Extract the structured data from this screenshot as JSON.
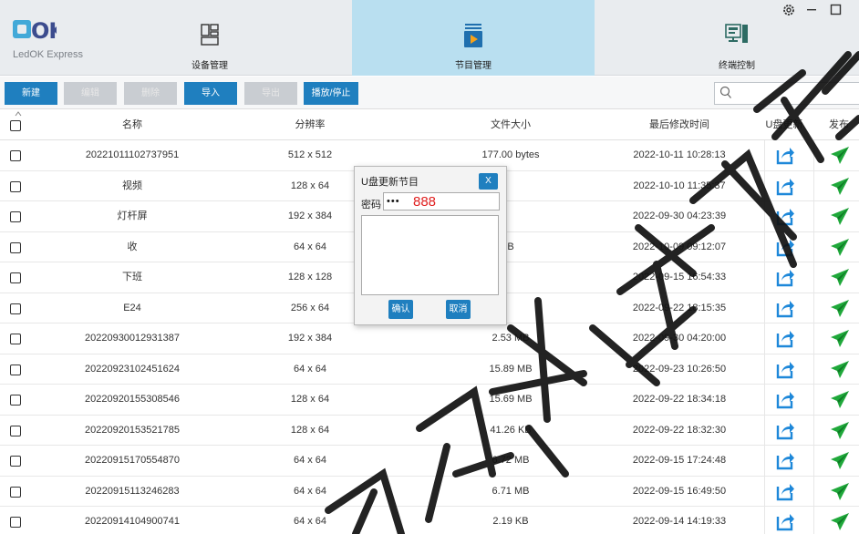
{
  "app": {
    "logo_text": "OK",
    "name": "LedOK Express"
  },
  "nav": {
    "device_label": "设备管理",
    "program_label": "节目管理",
    "terminal_label": "终端控制"
  },
  "window_controls": {
    "settings_icon": "gear-icon",
    "minimize_icon": "minimize-icon",
    "maximize_icon": "maximize-icon"
  },
  "toolbar": {
    "new_label": "新建",
    "edit_label": "编辑",
    "delete_label": "删除",
    "import_label": "导入",
    "export_label": "导出",
    "play_stop_label": "播放/停止",
    "search_placeholder": ""
  },
  "table": {
    "headers": {
      "name": "名称",
      "resolution": "分辨率",
      "size": "文件大小",
      "modified": "最后修改时间",
      "usb_update": "U盘更新",
      "publish": "发布"
    },
    "rows": [
      {
        "name": "20221011102737951",
        "resolution": "512 x 512",
        "size": "177.00 bytes",
        "modified": "2022-10-11 10:28:13"
      },
      {
        "name": "视频",
        "resolution": "128 x 64",
        "size": "",
        "modified": "2022-10-10 11:35:37"
      },
      {
        "name": "灯杆屏",
        "resolution": "192 x 384",
        "size": "",
        "modified": "2022-09-30 04:23:39"
      },
      {
        "name": "收",
        "resolution": "64 x 64",
        "size": "B",
        "modified": "2022-10-09 09:12:07"
      },
      {
        "name": "下班",
        "resolution": "128 x 128",
        "size": "",
        "modified": "2022-09-15 16:54:33"
      },
      {
        "name": "E24",
        "resolution": "256 x 64",
        "size": "",
        "modified": "2022-09-22 18:15:35"
      },
      {
        "name": "20220930012931387",
        "resolution": "192 x 384",
        "size": "2.53 MB",
        "modified": "2022-09-30 04:20:00"
      },
      {
        "name": "20220923102451624",
        "resolution": "64 x 64",
        "size": "15.89 MB",
        "modified": "2022-09-23 10:26:50"
      },
      {
        "name": "20220920155308546",
        "resolution": "128 x 64",
        "size": "15.69 MB",
        "modified": "2022-09-22 18:34:18"
      },
      {
        "name": "20220920153521785",
        "resolution": "128 x 64",
        "size": "41.26 KB",
        "modified": "2022-09-22 18:32:30"
      },
      {
        "name": "20220915170554870",
        "resolution": "64 x 64",
        "size": "6.72 MB",
        "modified": "2022-09-15 17:24:48"
      },
      {
        "name": "20220915113246283",
        "resolution": "64 x 64",
        "size": "6.71 MB",
        "modified": "2022-09-15 16:49:50"
      },
      {
        "name": "20220914104900741",
        "resolution": "64 x 64",
        "size": "2.19 KB",
        "modified": "2022-09-14 14:19:33"
      }
    ]
  },
  "dialog": {
    "title": "U盘更新节目",
    "close_label": "X",
    "password_label": "密码",
    "password_value": "•••",
    "password_note": "888",
    "confirm_label": "确认",
    "cancel_label": "取消"
  },
  "colors": {
    "accent": "#1f7fbf",
    "active_tab": "#b9dff0",
    "update_icon": "#1e88d9",
    "publish_icon": "#1fa83a"
  }
}
